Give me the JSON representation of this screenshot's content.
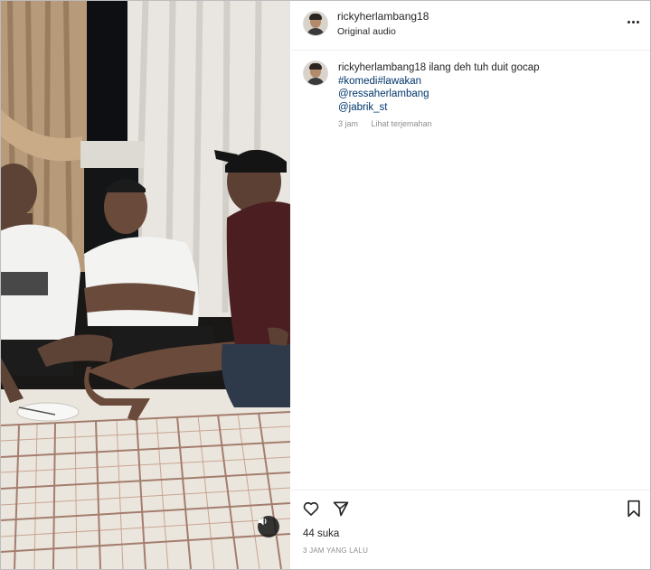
{
  "post": {
    "username": "rickyherlambang18",
    "audio_label": "Original audio"
  },
  "caption": {
    "username": "rickyherlambang18",
    "text": "ilang deh tuh duit gocap",
    "hashtag_1": "#komedi",
    "hashtag_2": "#lawakan",
    "mention_1": "@ressaherlambang",
    "mention_2": "@jabrik_st",
    "time": "3 jam",
    "translate_label": "Lihat terjemahan"
  },
  "footer": {
    "likes": "44 suka",
    "time_ago": "3 JAM YANG LALU"
  },
  "icons": {
    "more": "more-options-icon",
    "like": "heart-icon",
    "share": "paper-plane-icon",
    "save": "bookmark-icon",
    "mute": "speaker-icon"
  },
  "colors": {
    "link": "#00376b",
    "muted": "#8e8e8e",
    "text": "#262626"
  }
}
